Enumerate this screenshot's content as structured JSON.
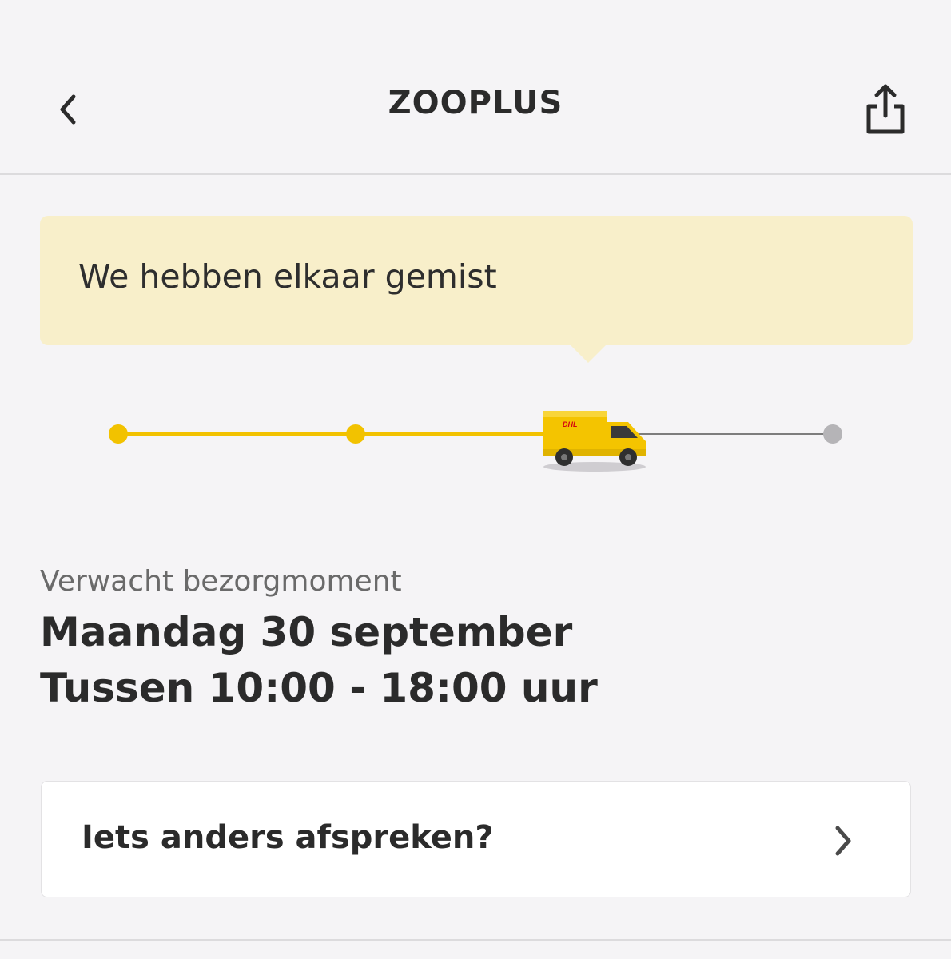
{
  "header": {
    "title": "ZOOPLUS",
    "back_icon": "chevron-left-icon",
    "share_icon": "share-icon"
  },
  "status": {
    "message": "We hebben elkaar gemist"
  },
  "progress": {
    "total_steps": 4,
    "current_step": 3,
    "vehicle_icon": "dhl-van-icon",
    "done_color": "#f2c200",
    "todo_color": "#b5b4b7"
  },
  "delivery": {
    "label": "Verwacht bezorgmoment",
    "date": "Maandag 30 september",
    "time": "Tussen 10:00 - 18:00 uur"
  },
  "action": {
    "label": "Iets anders afspreken?",
    "chevron_icon": "chevron-right-icon"
  },
  "colors": {
    "background": "#f5f4f6",
    "banner": "#f8efca",
    "accent": "#f2c200"
  }
}
